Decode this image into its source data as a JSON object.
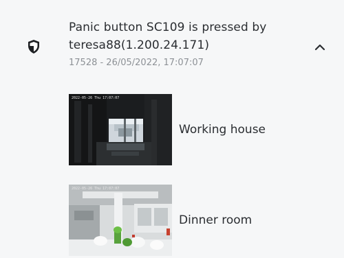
{
  "notification": {
    "title": "Panic button SC109 is pressed by teresa88(1.200.24.171)",
    "subtitle": "17528 - 26/05/2022, 17:07:07",
    "icon": "shield-icon",
    "expand_icon": "chevron-up-icon"
  },
  "cameras": [
    {
      "name": "Working house",
      "stamp": "2022-05-26 Thu 17:07:07"
    },
    {
      "name": "Dinner room",
      "stamp": "2022-05-26 Thu 17:07:07"
    }
  ],
  "colors": {
    "card_bg": "#f6f7f8",
    "text": "#2a2d31",
    "muted": "#8d9196"
  }
}
